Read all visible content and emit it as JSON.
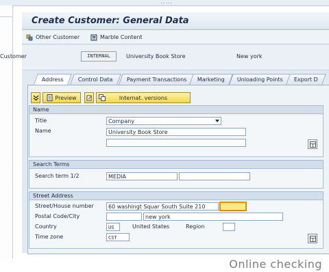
{
  "window": {
    "title": "Create Customer: General Data"
  },
  "toolbar": {
    "other_customer": "Other Customer",
    "marble_content": "Marble Content"
  },
  "header": {
    "customer_label": "Customer",
    "customer_value": "INTERNAL",
    "customer_name": "University Book Store",
    "city": "New york"
  },
  "tabs": [
    {
      "label": "Address"
    },
    {
      "label": "Control Data"
    },
    {
      "label": "Payment Transactions"
    },
    {
      "label": "Marketing"
    },
    {
      "label": "Unloading Points"
    },
    {
      "label": "Export D"
    }
  ],
  "buttons": {
    "preview": "Preview",
    "internat_versions": "Internat. versions"
  },
  "name_group": {
    "title": "Name",
    "title_label": "Title",
    "title_value": "Company",
    "name_label": "Name",
    "name_value": "University Book Store"
  },
  "search_group": {
    "title": "Search Terms",
    "search_label": "Search term 1/2",
    "search_value": "MEDIA"
  },
  "street_group": {
    "title": "Street Address",
    "street_label": "Street/House number",
    "street_value": "60 washingt Squar South Suite 210",
    "postal_label": "Postal Code/City",
    "city_value": "new york",
    "country_label": "Country",
    "country_code": "US",
    "country_name": "United States",
    "region_label": "Region",
    "timezone_label": "Time zone",
    "timezone_value": "CST"
  },
  "watermark": "Online checking",
  "top_handle": "....."
}
